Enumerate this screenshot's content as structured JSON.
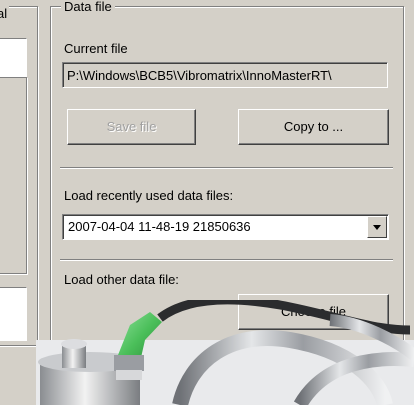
{
  "left_group": {
    "title_fragment": "al"
  },
  "data_file": {
    "title": "Data file",
    "current_file_label": "Current file",
    "current_file_value": "P:\\Windows\\BCB5\\Vibromatrix\\InnoMasterRT\\",
    "save_label": "Save file",
    "copy_label": "Copy to ...",
    "recent_label": "Load recently used data files:",
    "recent_selected": "2007-04-04 11-48-19 21850636",
    "other_label": "Load other data file:",
    "choose_label": "Choose file"
  },
  "colors": {
    "face": "#d4d0c8",
    "shadow": "#808080",
    "disabled": "#a0a0a0",
    "cable_green": "#4bbf5a"
  },
  "icons": [
    "chevron-down-icon",
    "sensor-photo"
  ]
}
